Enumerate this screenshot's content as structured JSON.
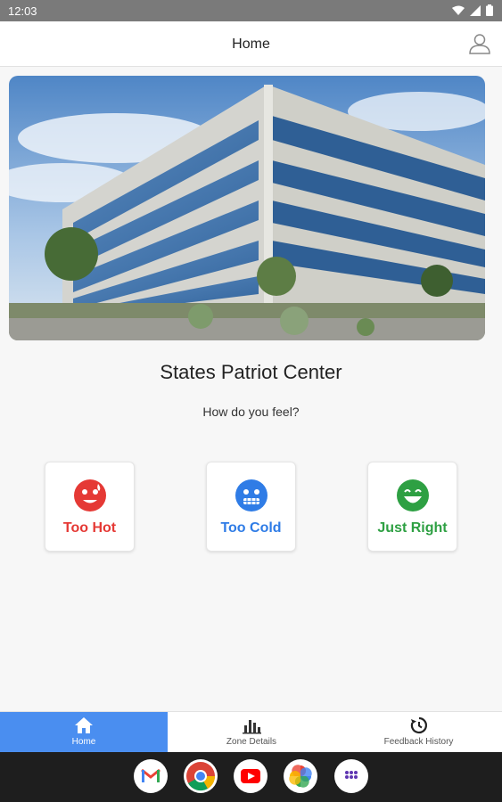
{
  "status_bar": {
    "time": "12:03"
  },
  "header": {
    "title": "Home"
  },
  "building": {
    "name": "States Patriot Center"
  },
  "prompt": "How do you feel?",
  "options": [
    {
      "label": "Too Hot",
      "color": "#e53935"
    },
    {
      "label": "Too Cold",
      "color": "#2f7ce6"
    },
    {
      "label": "Just Right",
      "color": "#2ea043"
    }
  ],
  "bottom_nav": {
    "active_color": "#4a8ef0",
    "items": [
      {
        "label": "Home",
        "icon": "home-icon"
      },
      {
        "label": "Zone Details",
        "icon": "bar-chart-icon"
      },
      {
        "label": "Feedback History",
        "icon": "history-icon"
      }
    ]
  },
  "dock": [
    "gmail-icon",
    "chrome-icon",
    "youtube-icon",
    "photos-icon",
    "app-drawer-icon"
  ]
}
